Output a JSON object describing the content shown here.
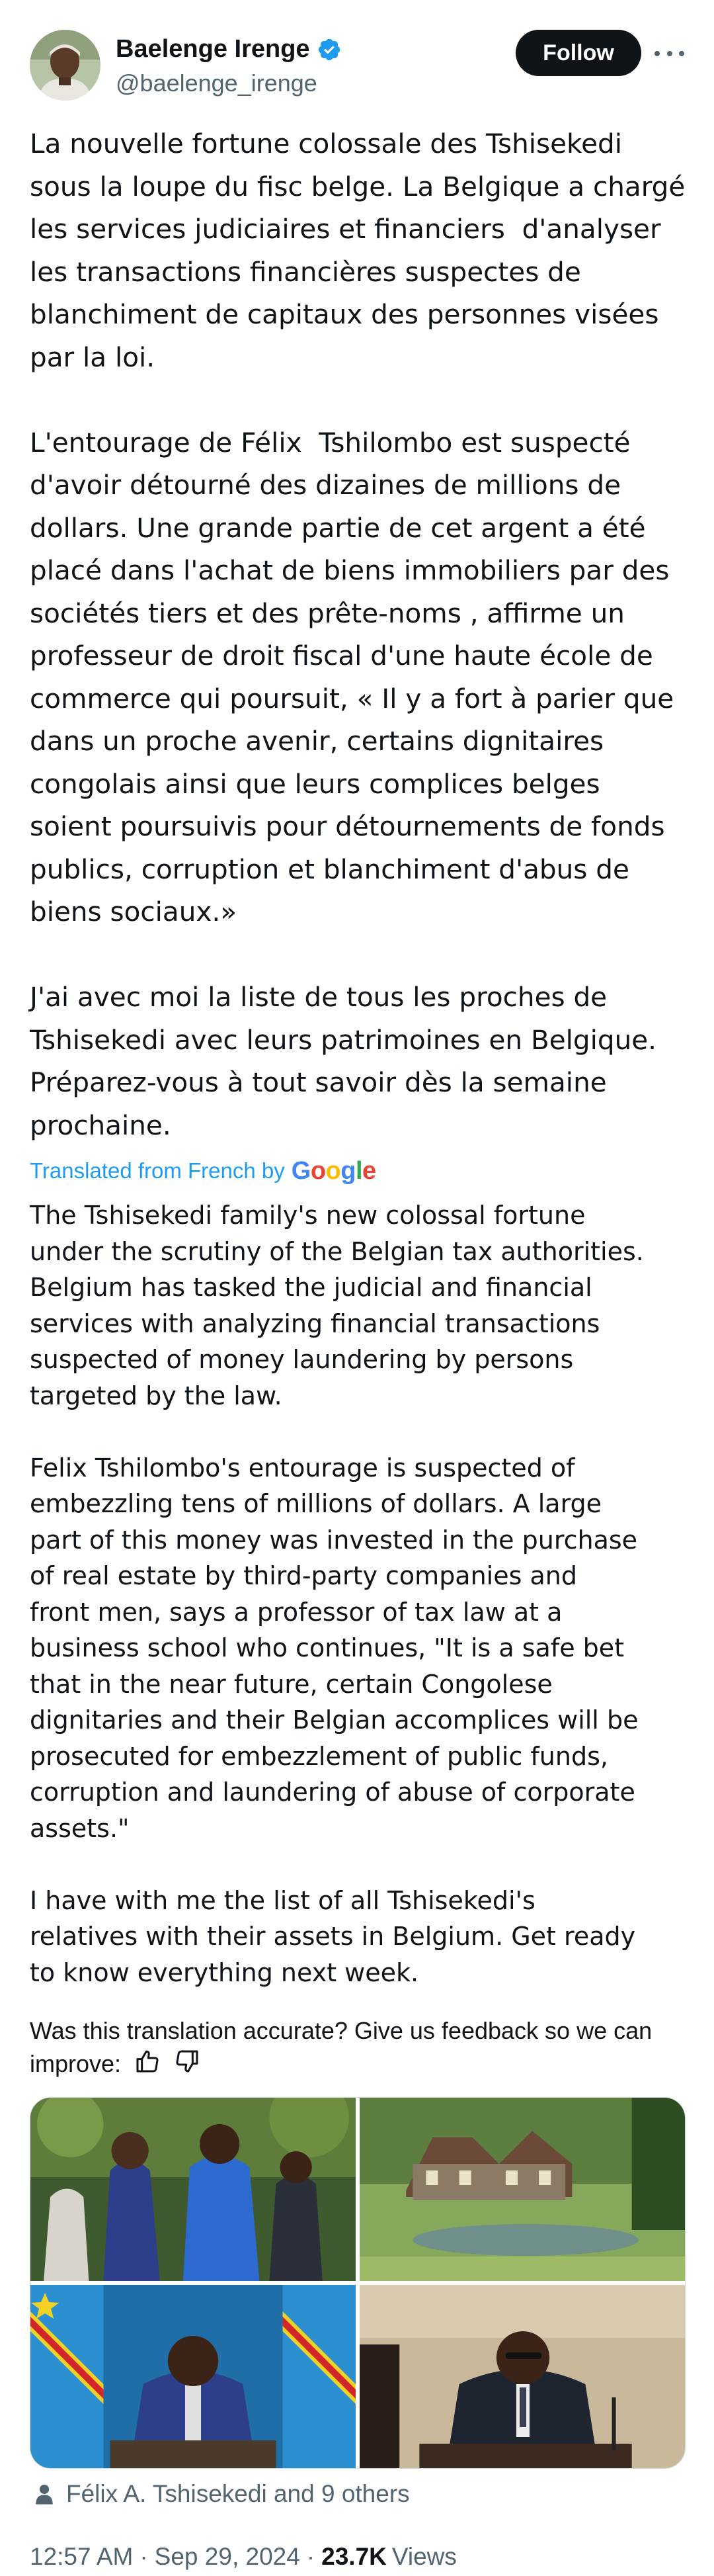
{
  "author": {
    "name": "Baelenge Irenge",
    "handle": "@baelenge_irenge",
    "verified_icon": "verified-badge-icon",
    "verified_color": "#1d9bf0"
  },
  "actions": {
    "follow_label": "Follow",
    "more_icon": "more-horizontal-icon"
  },
  "tweet": {
    "original_text": "La nouvelle fortune colossale des Tshisekedi\nsous la loupe du fisc belge. La Belgique a chargé\nles services judiciaires et financiers  d'analyser\nles transactions financières suspectes de\nblanchiment de capitaux des personnes visées\npar la loi.\n\nL'entourage de Félix  Tshilombo est suspecté\nd'avoir détourné des dizaines de millions de\ndollars. Une grande partie de cet argent a été\nplacé dans l'achat de biens immobiliers par des\nsociétés tiers et des prête-noms , affirme un\nprofesseur de droit fiscal d'une haute école de\ncommerce qui poursuit, « Il y a fort à parier que\ndans un proche avenir, certains dignitaires\ncongolais ainsi que leurs complices belges\nsoient poursuivis pour détournements de fonds\npublics, corruption et blanchiment d'abus de\nbiens sociaux.»\n\nJ'ai avec moi la liste de tous les proches de\nTshisekedi avec leurs patrimoines en Belgique.\nPréparez-vous à tout savoir dès la semaine\nprochaine.",
    "translated_from_label": "Translated from French by",
    "translator_logo": "Google",
    "translated_text": "The Tshisekedi family's new colossal fortune\nunder the scrutiny of the Belgian tax authorities.\nBelgium has tasked the judicial and financial\nservices with analyzing financial transactions\nsuspected of money laundering by persons\ntargeted by the law.\n\nFelix Tshilombo's entourage is suspected of\nembezzling tens of millions of dollars. A large\npart of this money was invested in the purchase\nof real estate by third-party companies and\nfront men, says a professor of tax law at a\nbusiness school who continues, \"It is a safe bet\nthat in the near future, certain Congolese\ndignitaries and their Belgian accomplices will be\nprosecuted for embezzlement of public funds,\ncorruption and laundering of abuse of corporate\nassets.\"\n\nI have with me the list of all Tshisekedi's\nrelatives with their assets in Belgium. Get ready\nto know everything next week.",
    "feedback_prompt": "Was this translation accurate? Give us feedback so we can improve:",
    "feedback_icons": [
      "thumbs-up-icon",
      "thumbs-down-icon"
    ]
  },
  "media": {
    "photos": [
      "photo-officials-walking",
      "photo-mansion-lawn",
      "photo-official-with-flag",
      "photo-official-at-desk"
    ],
    "tagged_icon": "person-icon",
    "tagged_text": "Félix A. Tshisekedi and 9 others"
  },
  "meta": {
    "time": "12:57 AM",
    "date": "Sep 29, 2024",
    "separator": "·",
    "views_count": "23.7K",
    "views_label": "Views"
  }
}
